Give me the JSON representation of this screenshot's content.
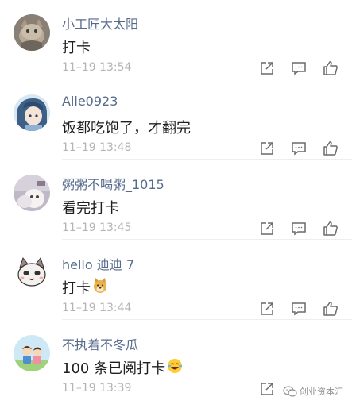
{
  "comments": [
    {
      "username": "小工匠大太阳",
      "text": "打卡",
      "time": "11–19 13:54",
      "emoji": ""
    },
    {
      "username": "Alie0923",
      "text": "饭都吃饱了，才翻完",
      "time": "11–19 13:48",
      "emoji": ""
    },
    {
      "username": "粥粥不喝粥_1015",
      "text": "看完打卡",
      "time": "11–19 13:45",
      "emoji": ""
    },
    {
      "username": "hello 迪迪 7",
      "text": "打卡",
      "time": "11–19 13:44",
      "emoji": "doge-emoji"
    },
    {
      "username": "不执着不冬瓜",
      "text": "100 条已阅打卡",
      "time": "11–19 13:39",
      "emoji": "laugh-cry-emoji"
    }
  ],
  "actions": {
    "share_icon": "share-icon",
    "reply_icon": "reply-icon",
    "like_icon": "thumbs-up-icon"
  },
  "watermark": {
    "text": "创业资本汇",
    "icon": "wechat-icon"
  },
  "colors": {
    "username": "#566a8c",
    "content": "#1f1f1f",
    "timestamp": "#b4b4b4",
    "icon": "#6a6a6a"
  }
}
